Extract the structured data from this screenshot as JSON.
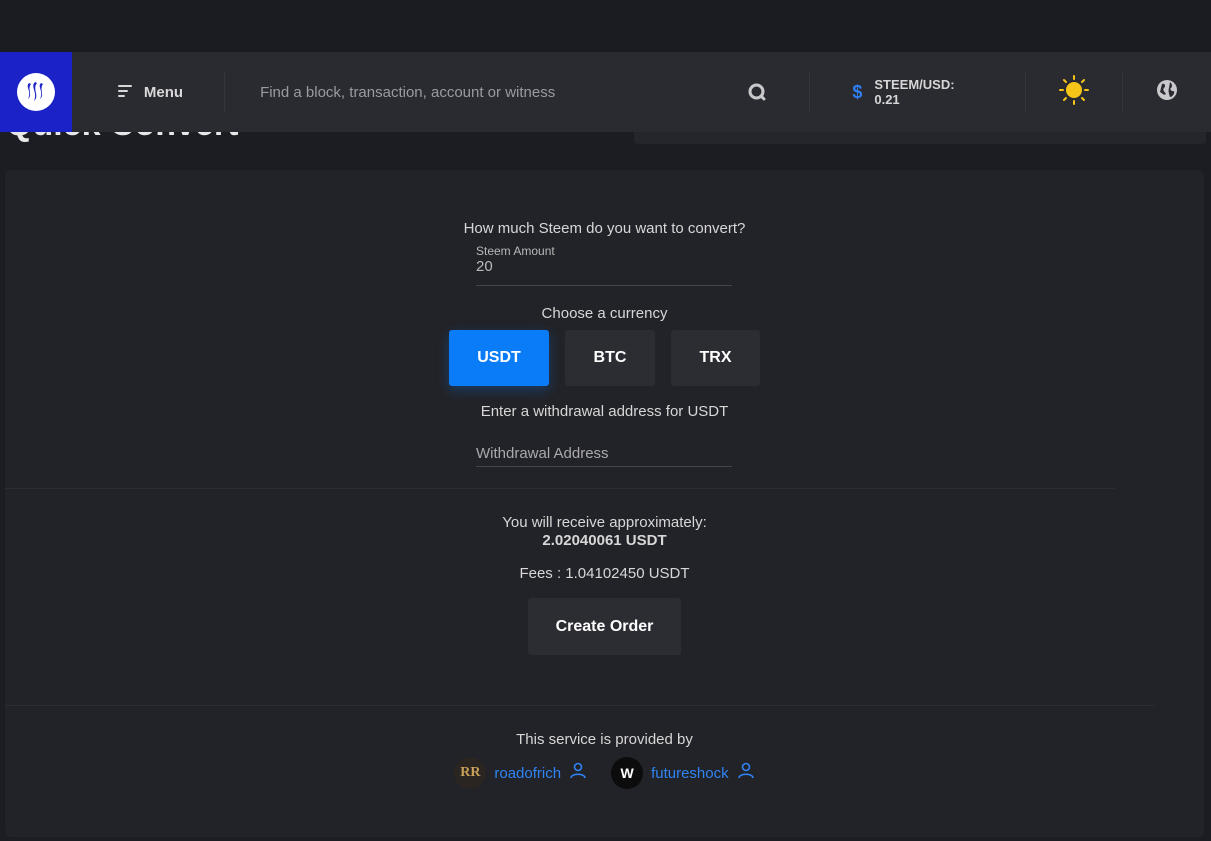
{
  "page": {
    "title": "Quick Convert"
  },
  "navbar": {
    "menu_label": "Menu",
    "search_placeholder": "Find a block, transaction, account or witness",
    "price_symbol": "$",
    "price_text": "STEEM/USD: 0.21"
  },
  "form": {
    "question": "How much Steem do you want to convert?",
    "amount_label": "Steem Amount",
    "amount_value": "20",
    "currency_prompt": "Choose a currency",
    "currencies": [
      "USDT",
      "BTC",
      "TRX"
    ],
    "selected_currency": "USDT",
    "address_prompt": "Enter a withdrawal address for USDT",
    "address_placeholder": "Withdrawal Address"
  },
  "summary": {
    "receive_label": "You will receive approximately:",
    "receive_amount": "2.02040061 USDT",
    "fees": "Fees : 1.04102450 USDT",
    "create_button": "Create Order"
  },
  "footer": {
    "provided_by": "This service is provided by",
    "providers": [
      {
        "name": "roadofrich",
        "avatar_text": "RR"
      },
      {
        "name": "futureshock",
        "avatar_text": "W"
      }
    ]
  },
  "colors": {
    "brand": "#1a22c8",
    "accent": "#0a7cf8",
    "link": "#2f85f5",
    "sun": "#f5c518"
  }
}
